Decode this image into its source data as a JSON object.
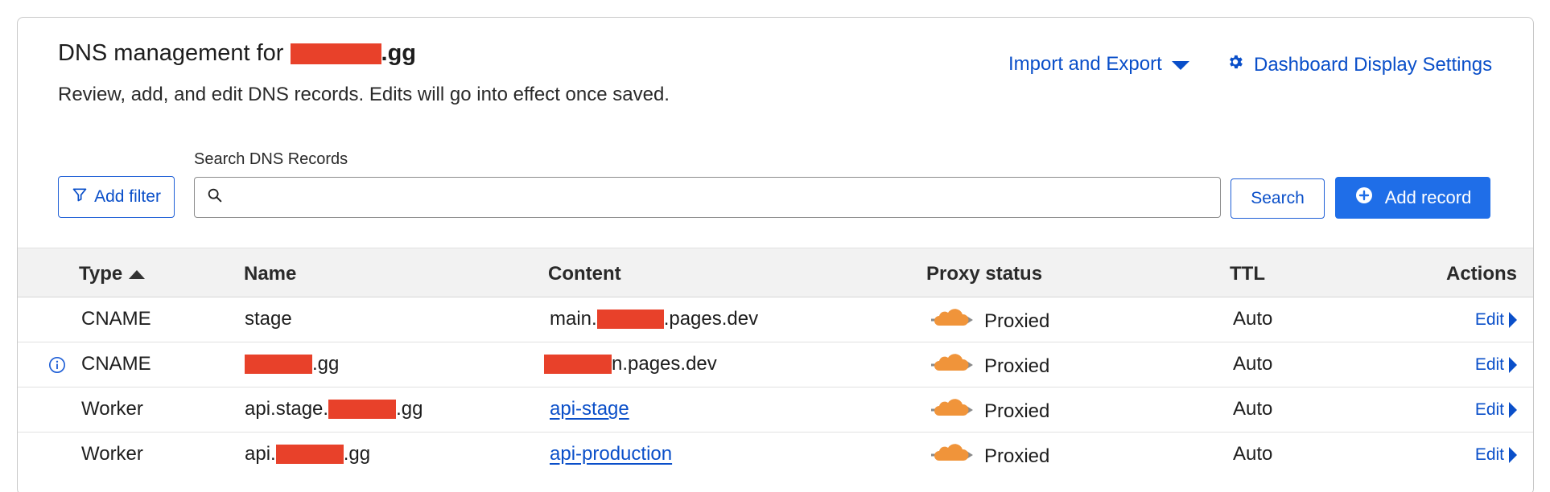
{
  "header": {
    "title_prefix": "DNS management for ",
    "title_suffix": ".gg",
    "subtitle": "Review, add, and edit DNS records. Edits will go into effect once saved.",
    "import_export_label": "Import and Export",
    "settings_label": "Dashboard Display Settings"
  },
  "toolbar": {
    "filter_label": "Add filter",
    "search_label": "Search DNS Records",
    "search_value": "",
    "search_button_label": "Search",
    "add_record_label": "Add record"
  },
  "table": {
    "columns": [
      "Type",
      "Name",
      "Content",
      "Proxy status",
      "TTL",
      "Actions"
    ],
    "rows": [
      {
        "type": "CNAME",
        "name_prefix": "stage",
        "name_suffix": "",
        "content_prefix": "main.",
        "content_suffix": ".pages.dev",
        "proxy": "Proxied",
        "ttl": "Auto",
        "action": "Edit"
      },
      {
        "type": "CNAME",
        "name_prefix": "",
        "name_suffix": ".gg",
        "content_prefix": "",
        "content_suffix": "n.pages.dev",
        "proxy": "Proxied",
        "ttl": "Auto",
        "action": "Edit"
      },
      {
        "type": "Worker",
        "name_prefix": "api.stage.",
        "name_suffix": ".gg",
        "content_link": "api-stage",
        "proxy": "Proxied",
        "ttl": "Auto",
        "action": "Edit"
      },
      {
        "type": "Worker",
        "name_prefix": "api.",
        "name_suffix": ".gg",
        "content_link": "api-production",
        "proxy": "Proxied",
        "ttl": "Auto",
        "action": "Edit"
      }
    ]
  },
  "colors": {
    "accent": "#1f6ee8",
    "link": "#0a4fc9",
    "redaction": "#e8412a",
    "cloud": "#f0943a"
  }
}
